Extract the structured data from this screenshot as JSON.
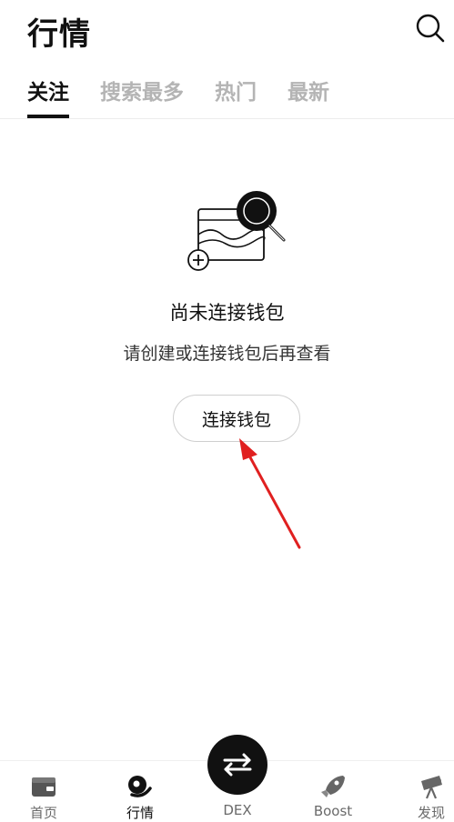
{
  "header": {
    "title": "行情",
    "search_icon": "search-icon"
  },
  "tabs": [
    {
      "label": "关注",
      "active": true
    },
    {
      "label": "搜索最多",
      "active": false
    },
    {
      "label": "热门",
      "active": false
    },
    {
      "label": "最新",
      "active": false
    }
  ],
  "empty_state": {
    "illustration_icon": "wallet-search-illustration",
    "title": "尚未连接钱包",
    "subtitle": "请创建或连接钱包后再查看",
    "button_label": "连接钱包"
  },
  "annotation": {
    "arrow_color": "#e02020"
  },
  "bottom_nav": {
    "items": [
      {
        "label": "首页",
        "icon": "wallet-icon"
      },
      {
        "label": "行情",
        "icon": "market-icon",
        "active": true
      },
      {
        "label": "DEX",
        "icon": "swap-icon"
      },
      {
        "label": "Boost",
        "icon": "rocket-icon"
      },
      {
        "label": "发现",
        "icon": "telescope-icon"
      }
    ]
  }
}
